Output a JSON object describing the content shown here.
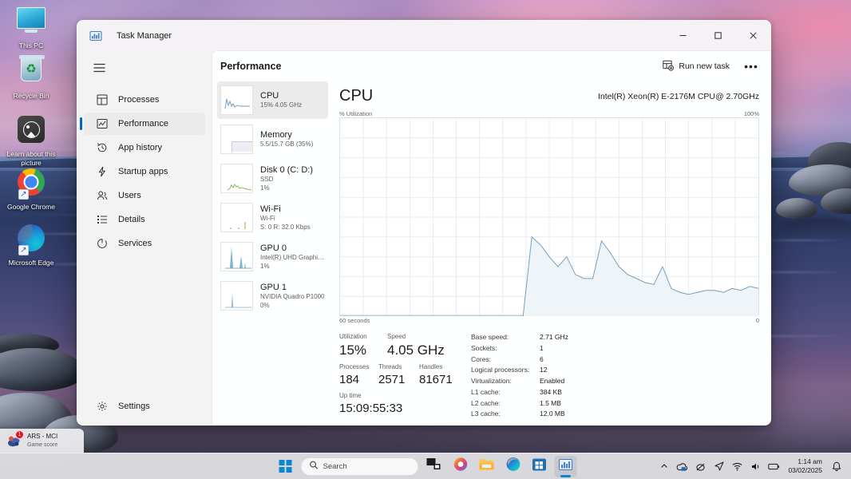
{
  "desktop": {
    "icons": [
      {
        "name": "This PC",
        "icon": "this-pc-icon"
      },
      {
        "name": "Recycle Bin",
        "icon": "recycle-bin-icon"
      },
      {
        "name": "Learn about this picture",
        "icon": "learn-about-picture-icon"
      },
      {
        "name": "Google Chrome",
        "icon": "google-chrome-icon"
      },
      {
        "name": "Microsoft Edge",
        "icon": "microsoft-edge-icon"
      }
    ]
  },
  "window": {
    "title": "Task Manager",
    "minimize": "–",
    "maximize": "☐",
    "close": "✕"
  },
  "sidebar": {
    "menu_label": "Open navigation",
    "items": [
      {
        "label": "Processes",
        "icon": "processes-icon",
        "active": false
      },
      {
        "label": "Performance",
        "icon": "performance-icon",
        "active": true
      },
      {
        "label": "App history",
        "icon": "app-history-icon",
        "active": false
      },
      {
        "label": "Startup apps",
        "icon": "startup-apps-icon",
        "active": false
      },
      {
        "label": "Users",
        "icon": "users-icon",
        "active": false
      },
      {
        "label": "Details",
        "icon": "details-icon",
        "active": false
      },
      {
        "label": "Services",
        "icon": "services-icon",
        "active": false
      }
    ],
    "settings": {
      "label": "Settings",
      "icon": "gear-icon"
    }
  },
  "header": {
    "title": "Performance",
    "run_new_task": "Run new task",
    "more": "•••"
  },
  "resources": [
    {
      "name": "CPU",
      "line1": "15% 4.05 GHz",
      "line2": "",
      "active": true,
      "color": "#6f9cbd"
    },
    {
      "name": "Memory",
      "line1": "5.5/15.7 GB (35%)",
      "line2": "",
      "active": false,
      "color": "#a08fbe"
    },
    {
      "name": "Disk 0 (C: D:)",
      "line1": "SSD",
      "line2": "1%",
      "active": false,
      "color": "#8bb56a"
    },
    {
      "name": "Wi-Fi",
      "line1": "Wi-Fi",
      "line2": "S: 0 R: 32.0 Kbps",
      "active": false,
      "color": "#c0a860"
    },
    {
      "name": "GPU 0",
      "line1": "Intel(R) UHD Graphic...",
      "line2": "1%",
      "active": false,
      "color": "#5f93b5"
    },
    {
      "name": "GPU 1",
      "line1": "NVIDIA Quadro P1000",
      "line2": "0%",
      "active": false,
      "color": "#5f93b5"
    }
  ],
  "cpu_panel": {
    "title": "CPU",
    "cpu_name": "Intel(R) Xeon(R) E-2176M CPU@ 2.70GHz",
    "y_axis_label": "% Utilization",
    "y_axis_max": "100%",
    "x_axis_left": "60 seconds",
    "x_axis_right": "0",
    "stats": [
      {
        "label": "Utilization",
        "value": "15%"
      },
      {
        "label": "Speed",
        "value": "4.05 GHz"
      },
      {
        "label": "Processes",
        "value": "184"
      },
      {
        "label": "Threads",
        "value": "2571"
      },
      {
        "label": "Handles",
        "value": "81671"
      },
      {
        "label": "Up time",
        "value": "15:09:55:33"
      }
    ],
    "specs": [
      {
        "key": "Base speed:",
        "value": "2.71 GHz"
      },
      {
        "key": "Sockets:",
        "value": "1"
      },
      {
        "key": "Cores:",
        "value": "6"
      },
      {
        "key": "Logical processors:",
        "value": "12"
      },
      {
        "key": "Virtualization:",
        "value": "Enabled"
      },
      {
        "key": "L1 cache:",
        "value": "384 KB"
      },
      {
        "key": "L2 cache:",
        "value": "1.5 MB"
      },
      {
        "key": "L3 cache:",
        "value": "12.0 MB"
      }
    ]
  },
  "chart_data": {
    "type": "area",
    "title": "CPU % Utilization",
    "xlabel": "60 seconds",
    "ylabel": "% Utilization",
    "ylim": [
      0,
      100
    ],
    "xlim": [
      60,
      0
    ],
    "grid": true,
    "legend": false,
    "line_color": "#76a0bd",
    "fill_color": "#eef4f8",
    "x_seconds_ago": [
      60,
      58,
      56,
      54,
      52,
      50,
      48,
      46,
      44,
      42,
      40,
      38,
      36,
      35,
      34,
      33,
      32,
      31,
      30,
      29,
      28,
      27,
      26,
      25,
      24,
      23,
      22,
      21,
      20,
      19,
      18,
      17,
      16,
      15,
      14,
      13,
      12,
      11,
      10,
      9,
      8,
      7,
      6,
      5,
      4,
      3,
      2,
      1,
      0
    ],
    "values": [
      0,
      0,
      0,
      0,
      0,
      0,
      0,
      0,
      0,
      0,
      0,
      0,
      0,
      0,
      0,
      0,
      0,
      0,
      0,
      0,
      0,
      0,
      40,
      36,
      30,
      25,
      30,
      21,
      19,
      19,
      38,
      32,
      25,
      21,
      19,
      17,
      16,
      25,
      14,
      12,
      11,
      12,
      13,
      13,
      12,
      14,
      13,
      15,
      14
    ]
  },
  "taskbar": {
    "start": "start-icon",
    "search_placeholder": "Search",
    "apps": [
      {
        "name": "task-view-icon",
        "running": false,
        "active": false
      },
      {
        "name": "copilot-icon",
        "running": false,
        "active": false
      },
      {
        "name": "file-explorer-icon",
        "running": false,
        "active": false
      },
      {
        "name": "microsoft-edge-icon",
        "running": false,
        "active": false
      },
      {
        "name": "microsoft-store-icon",
        "running": false,
        "active": false
      },
      {
        "name": "task-manager-icon",
        "running": true,
        "active": true
      }
    ],
    "tray": {
      "chevron": "show-hidden-icons",
      "onedrive": "onedrive-icon",
      "mouse": "mouse-icon",
      "send": "send-icon",
      "wifi": "wifi-icon",
      "volume": "volume-icon",
      "battery": "battery-icon",
      "time": "1:14 am",
      "date": "03/02/2025",
      "notifications": "notification-bell-icon"
    }
  },
  "gamebar": {
    "title": "ARS - MCI",
    "subtitle": "Game score",
    "badge": "1"
  }
}
